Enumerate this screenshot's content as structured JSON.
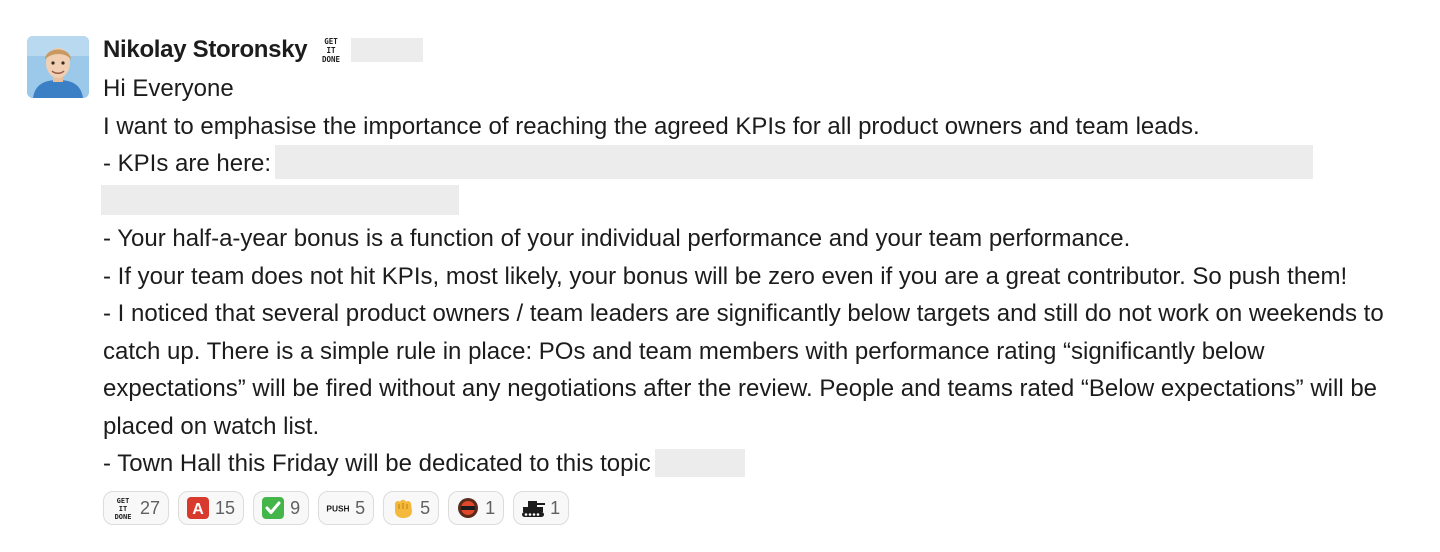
{
  "message": {
    "sender": "Nikolay Storonsky",
    "status_emoji": "get-it-done-emoji",
    "greeting": "Hi Everyone",
    "intro": "I want to emphasise the importance of reaching the agreed KPIs for all product owners and team leads.",
    "kpi_prefix": "- KPIs are here:",
    "bullet_bonus": "- Your half-a-year bonus is a function of your individual performance and your team performance.",
    "bullet_team": "- If your team does not hit KPIs, most likely, your bonus will be zero even if you are a great contributor. So push them!",
    "bullet_noticed": "- I noticed that several product owners / team leaders are significantly below targets and still do not work on weekends to catch up. There is a simple rule in place: POs and team members with performance rating “significantly below expectations” will be fired without any negotiations after the review. People and teams rated “Below expectations” will be placed on watch list.",
    "bullet_townhall": "- Town Hall this Friday will be dedicated to this topic"
  },
  "reactions": [
    {
      "emoji": "get-it-done-emoji",
      "count": "27"
    },
    {
      "emoji": "red-a-emoji",
      "count": "15"
    },
    {
      "emoji": "green-check-emoji",
      "count": "9"
    },
    {
      "emoji": "push-emoji",
      "count": "5"
    },
    {
      "emoji": "fist-emoji",
      "count": "5"
    },
    {
      "emoji": "round-face-emoji",
      "count": "1"
    },
    {
      "emoji": "tank-emoji",
      "count": "1"
    }
  ],
  "emoji_text": {
    "get_it_done": [
      "GET",
      "IT",
      "DONE"
    ],
    "red_a": "A",
    "push": "PUSH"
  },
  "colors": {
    "text": "#1d1c1d",
    "muted": "#616061",
    "redacted": "#ececec",
    "reaction_bg": "#f8f8f8",
    "reaction_border": "#dcdcdc",
    "red_a": "#d93a2e",
    "green_check": "#44b649"
  }
}
